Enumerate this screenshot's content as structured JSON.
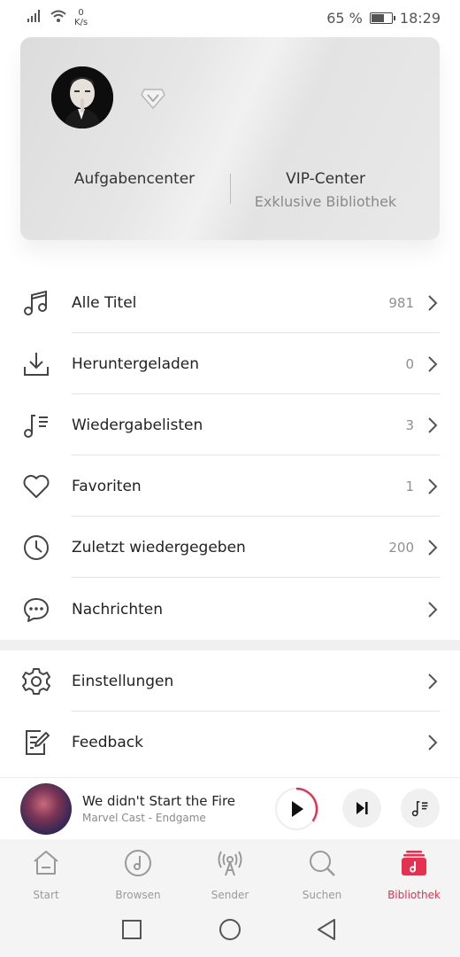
{
  "status_bar": {
    "net_speed_value": "0",
    "net_speed_unit": "K/s",
    "battery": "65 %",
    "time": "18:29"
  },
  "profile_card": {
    "tasks_label": "Aufgabencenter",
    "vip_label": "VIP-Center",
    "vip_sub": "Exklusive Bibliothek"
  },
  "library": {
    "items": [
      {
        "label": "Alle Titel",
        "count": "981",
        "icon": "music-note-icon"
      },
      {
        "label": "Heruntergeladen",
        "count": "0",
        "icon": "download-icon"
      },
      {
        "label": "Wiedergabelisten",
        "count": "3",
        "icon": "playlist-icon"
      },
      {
        "label": "Favoriten",
        "count": "1",
        "icon": "heart-icon"
      },
      {
        "label": "Zuletzt wiedergegeben",
        "count": "200",
        "icon": "clock-icon"
      },
      {
        "label": "Nachrichten",
        "count": "",
        "icon": "chat-bubble-icon"
      }
    ],
    "extra": [
      {
        "label": "Einstellungen",
        "icon": "gear-icon"
      },
      {
        "label": "Feedback",
        "icon": "feedback-icon"
      }
    ]
  },
  "player": {
    "title": "We didn't Start the Fire",
    "artist": "Marvel Cast - Endgame",
    "progress": 0.35,
    "accent": "#e5304f"
  },
  "tabs": [
    {
      "label": "Start",
      "icon": "home-icon"
    },
    {
      "label": "Browsen",
      "icon": "browse-icon"
    },
    {
      "label": "Sender",
      "icon": "radio-tower-icon"
    },
    {
      "label": "Suchen",
      "icon": "search-icon"
    },
    {
      "label": "Bibliothek",
      "icon": "library-icon",
      "active": true
    }
  ]
}
